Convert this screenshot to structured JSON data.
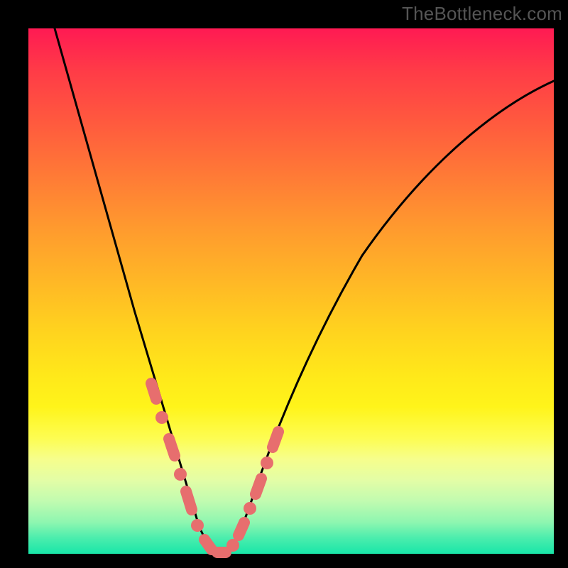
{
  "watermark": "TheBottleneck.com",
  "chart_data": {
    "type": "line",
    "title": "",
    "xlabel": "",
    "ylabel": "",
    "xlim": [
      0,
      100
    ],
    "ylim": [
      0,
      100
    ],
    "background_gradient": {
      "top": "#ff1a53",
      "bottom": "#18e6a8",
      "stops": [
        "red",
        "orange",
        "yellow",
        "green"
      ]
    },
    "series": [
      {
        "name": "bottleneck-curve",
        "x": [
          5,
          8,
          12,
          16,
          20,
          23,
          26,
          28,
          30,
          32,
          34,
          36,
          38,
          40,
          44,
          48,
          54,
          62,
          72,
          84,
          100
        ],
        "y": [
          100,
          88,
          74,
          60,
          45,
          34,
          24,
          16,
          9,
          4,
          1,
          0,
          1,
          4,
          12,
          22,
          35,
          50,
          64,
          76,
          86
        ]
      }
    ],
    "highlight_points": {
      "name": "pink-dots",
      "color": "#e76e6e",
      "x": [
        23,
        24.5,
        26,
        28,
        30,
        31.5,
        33,
        35,
        37,
        38,
        39,
        40.5,
        42,
        43.5,
        45,
        46.5
      ],
      "y": [
        34,
        29,
        24,
        16,
        9,
        5.5,
        2,
        0,
        0.5,
        2,
        4,
        7,
        10,
        13,
        16,
        20
      ]
    }
  }
}
